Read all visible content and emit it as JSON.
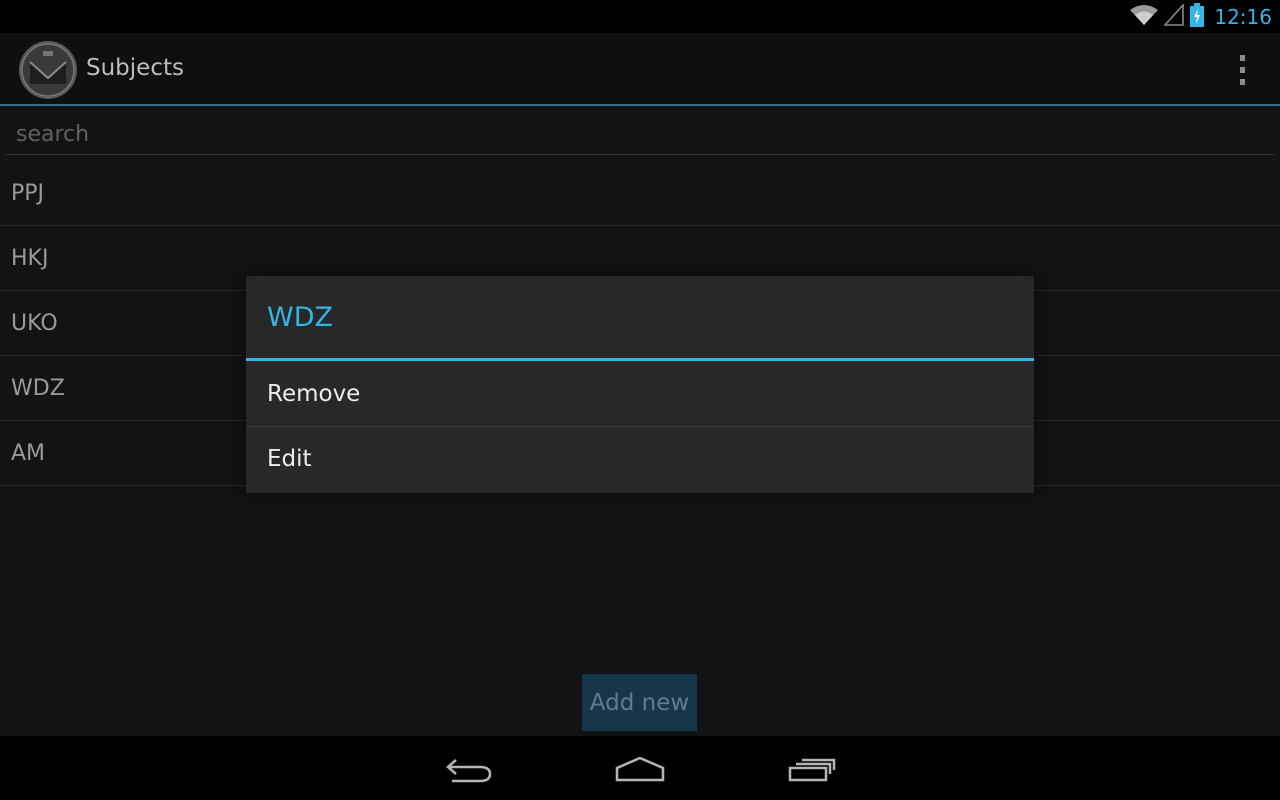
{
  "status_bar": {
    "time": "12:16",
    "icons": [
      "wifi-icon",
      "cell-signal-icon",
      "battery-charging-icon"
    ]
  },
  "action_bar": {
    "title": "Subjects",
    "app_icon": "mail-envelope-icon",
    "overflow_icon": "overflow-menu-icon"
  },
  "search": {
    "placeholder": "search",
    "value": ""
  },
  "subjects": [
    "PPJ",
    "HKJ",
    "UKO",
    "WDZ",
    "AM"
  ],
  "add_button": {
    "label": "Add new"
  },
  "dialog": {
    "title": "WDZ",
    "items": [
      "Remove",
      "Edit"
    ]
  },
  "nav_bar": {
    "icons": [
      "back-icon",
      "home-icon",
      "recents-icon"
    ]
  },
  "colors": {
    "accent": "#33b5e5",
    "background": "#121314",
    "dialog_bg": "#282828"
  }
}
